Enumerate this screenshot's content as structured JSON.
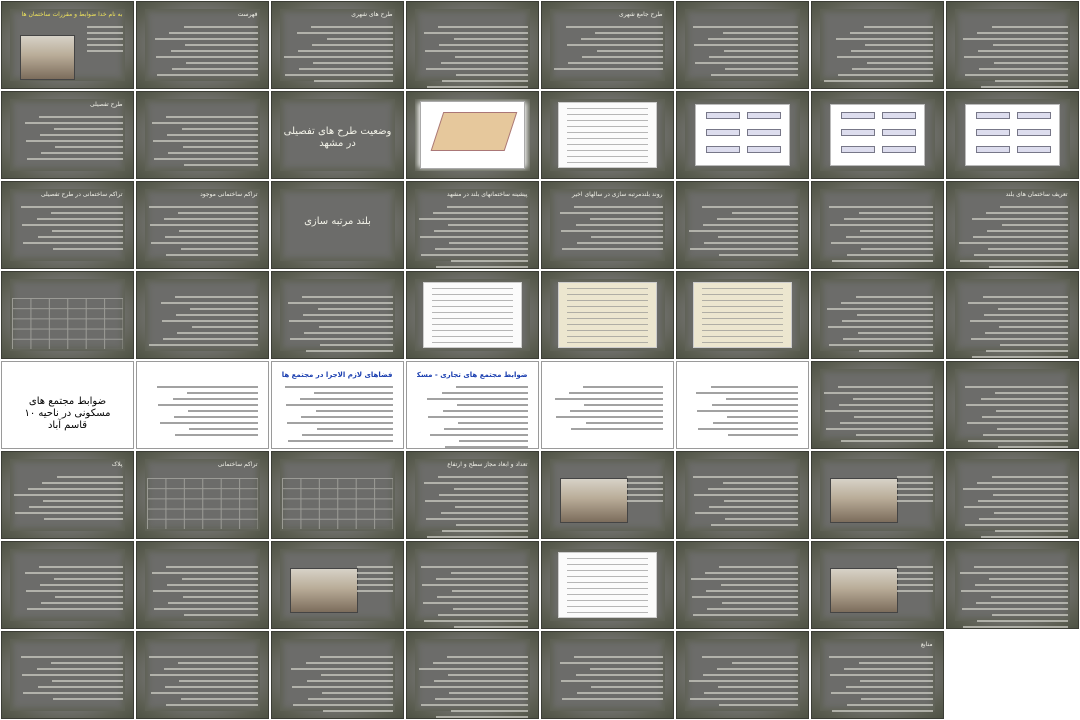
{
  "window": {
    "title": "ضوابط و مقررات ساختمان ها"
  },
  "colors": {
    "slide_bg": "#6c6c6a",
    "border_olive": "#4e5244",
    "title_blue": "#1b3fb0",
    "title_yellow": "#f0e45a"
  },
  "slides": [
    {
      "title": "به نام خدا ضوابط و مقررات ساختمان ها",
      "kind": "photo"
    },
    {
      "title": "فهرست",
      "kind": "text"
    },
    {
      "title": "طرح های شهری",
      "kind": "text"
    },
    {
      "title": "",
      "kind": "text"
    },
    {
      "title": "طرح جامع شهری",
      "kind": "text"
    },
    {
      "title": "",
      "kind": "text"
    },
    {
      "title": "",
      "kind": "text"
    },
    {
      "title": "",
      "kind": "text"
    },
    {
      "title": "طرح تفصیلی",
      "kind": "text"
    },
    {
      "title": "",
      "kind": "text"
    },
    {
      "title": "وضعیت طرح های تفصیلی در مشهد",
      "kind": "title"
    },
    {
      "title": "",
      "kind": "map"
    },
    {
      "title": "",
      "kind": "doc"
    },
    {
      "title": "",
      "kind": "chart"
    },
    {
      "title": "",
      "kind": "chart"
    },
    {
      "title": "",
      "kind": "chart"
    },
    {
      "title": "تراکم ساختمانی در طرح تفصیلی",
      "kind": "text"
    },
    {
      "title": "تراکم ساختمانی موجود",
      "kind": "text"
    },
    {
      "title": "بلند مرتبه سازی",
      "kind": "title"
    },
    {
      "title": "پیشینه ساختمانهای بلند در مشهد",
      "kind": "text"
    },
    {
      "title": "روند بلندمرتبه سازی در سالهای اخیر",
      "kind": "text"
    },
    {
      "title": "",
      "kind": "text"
    },
    {
      "title": "",
      "kind": "text"
    },
    {
      "title": "تعریف ساختمان های بلند",
      "kind": "text"
    },
    {
      "title": "",
      "kind": "table"
    },
    {
      "title": "",
      "kind": "text"
    },
    {
      "title": "",
      "kind": "text"
    },
    {
      "title": "",
      "kind": "doc"
    },
    {
      "title": "",
      "kind": "doctan"
    },
    {
      "title": "",
      "kind": "doctan"
    },
    {
      "title": "",
      "kind": "text"
    },
    {
      "title": "",
      "kind": "text"
    },
    {
      "title": "ضوابط مجتمع های مسکونی در ناحیه ۱۰ قاسم آباد",
      "kind": "whitebig"
    },
    {
      "title": "",
      "kind": "white"
    },
    {
      "title": "فضاهای لازم الاجرا در مجتمع های مسکونی",
      "kind": "whiteblue"
    },
    {
      "title": "ضوابط مجتمع های تجاری - مسکونی",
      "kind": "whiteblue"
    },
    {
      "title": "",
      "kind": "white"
    },
    {
      "title": "",
      "kind": "white"
    },
    {
      "title": "",
      "kind": "text"
    },
    {
      "title": "",
      "kind": "text"
    },
    {
      "title": "پلاک",
      "kind": "text"
    },
    {
      "title": "تراکم ساختمانی",
      "kind": "table"
    },
    {
      "title": "",
      "kind": "table"
    },
    {
      "title": "تعداد و ابعاد مجاز سطح و ارتفاع",
      "kind": "text"
    },
    {
      "title": "",
      "kind": "photo"
    },
    {
      "title": "",
      "kind": "text"
    },
    {
      "title": "",
      "kind": "photo"
    },
    {
      "title": "",
      "kind": "text"
    },
    {
      "title": "",
      "kind": "text"
    },
    {
      "title": "",
      "kind": "text"
    },
    {
      "title": "",
      "kind": "photo"
    },
    {
      "title": "",
      "kind": "text"
    },
    {
      "title": "",
      "kind": "doc"
    },
    {
      "title": "",
      "kind": "text"
    },
    {
      "title": "",
      "kind": "photo"
    },
    {
      "title": "",
      "kind": "text"
    },
    {
      "title": "",
      "kind": "text"
    },
    {
      "title": "",
      "kind": "text"
    },
    {
      "title": "",
      "kind": "text"
    },
    {
      "title": "",
      "kind": "text"
    },
    {
      "title": "",
      "kind": "text"
    },
    {
      "title": "",
      "kind": "text"
    },
    {
      "title": "منابع",
      "kind": "text"
    }
  ]
}
